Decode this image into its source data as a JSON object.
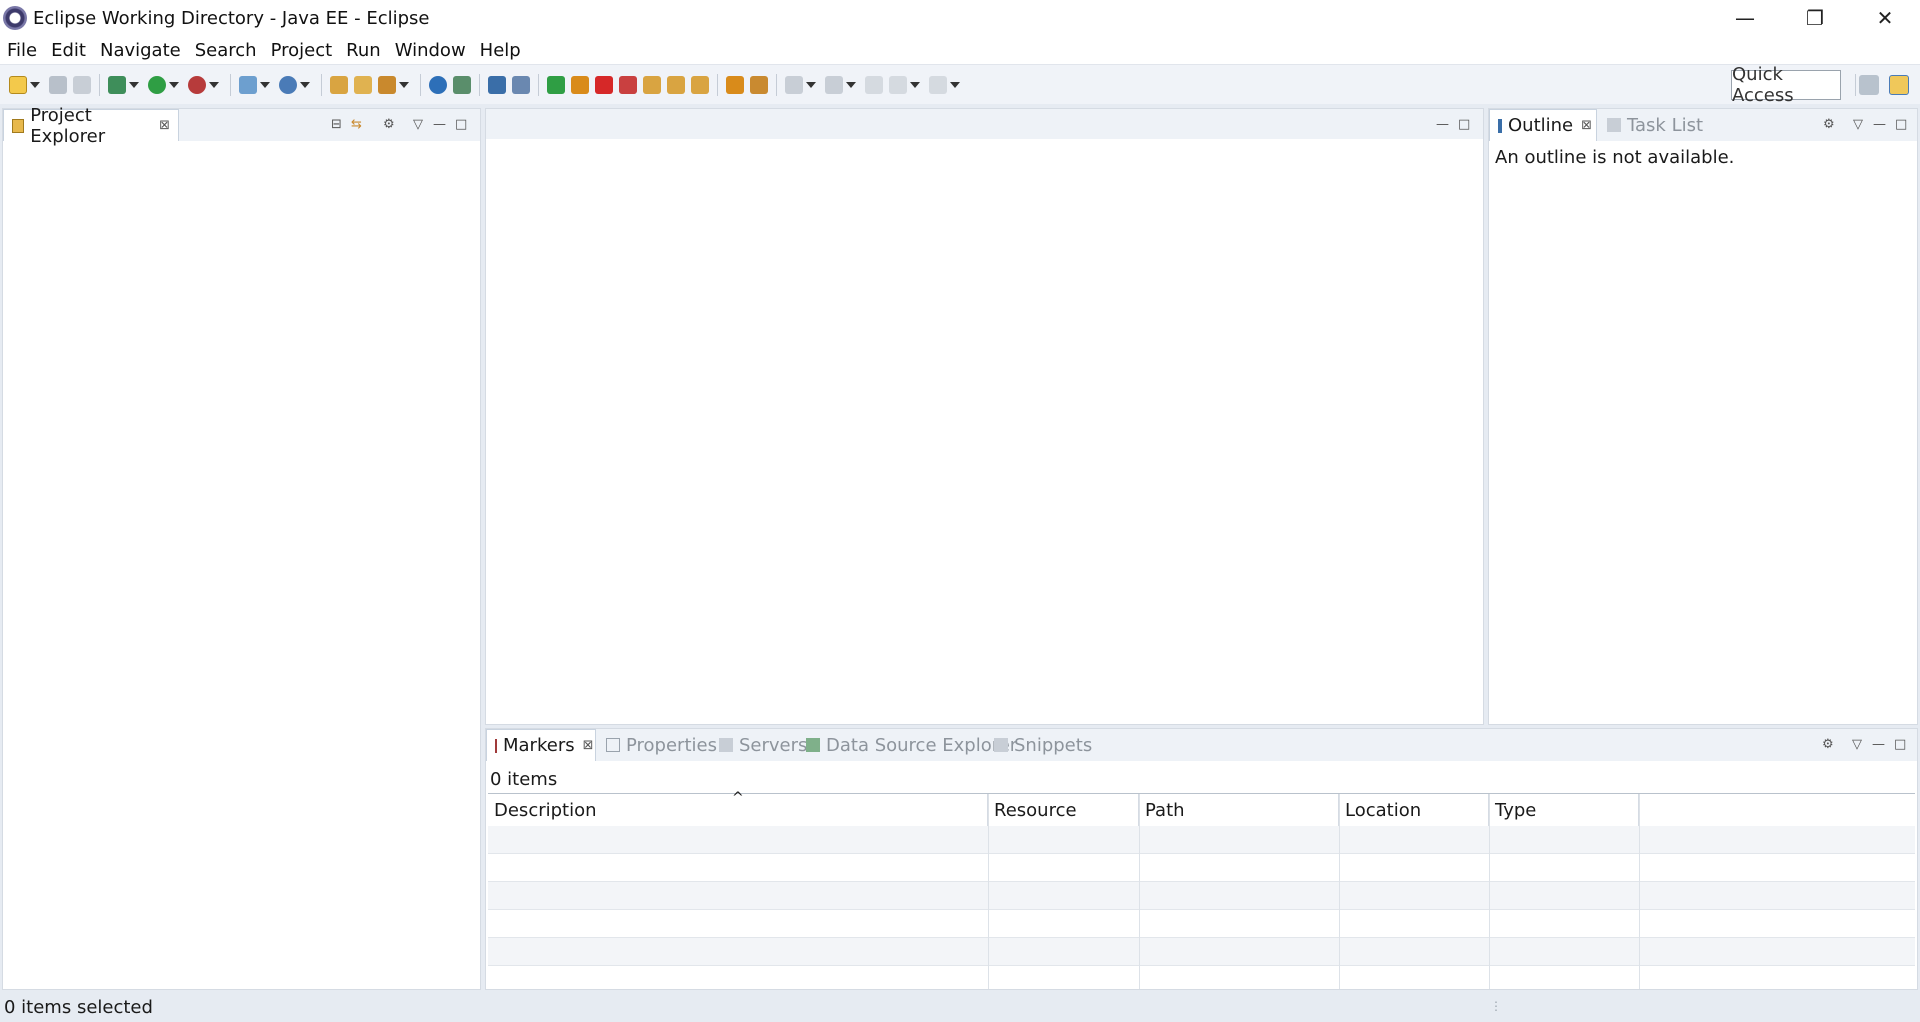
{
  "window": {
    "title": "Eclipse Working Directory - Java EE - Eclipse",
    "minimize": "—",
    "restore": "❐",
    "close": "✕"
  },
  "menu": [
    "File",
    "Edit",
    "Navigate",
    "Search",
    "Project",
    "Run",
    "Window",
    "Help"
  ],
  "toolbar": {
    "quick_access": "Quick Access"
  },
  "project_explorer": {
    "tab_label": "Project Explorer"
  },
  "outline_panel": {
    "tabs": [
      {
        "label": "Outline",
        "active": true
      },
      {
        "label": "Task List",
        "active": false
      }
    ],
    "message": "An outline is not available."
  },
  "bottom_panel": {
    "tabs": [
      {
        "label": "Markers",
        "active": true
      },
      {
        "label": "Properties",
        "active": false
      },
      {
        "label": "Servers",
        "active": false
      },
      {
        "label": "Data Source Explorer",
        "active": false
      },
      {
        "label": "Snippets",
        "active": false
      }
    ],
    "items_count": "0 items",
    "sort_indicator": "^",
    "columns": [
      "Description",
      "Resource",
      "Path",
      "Location",
      "Type"
    ]
  },
  "status": {
    "text": "0 items selected"
  },
  "colors": {
    "accent_green": "#2f9e44",
    "accent_red": "#d62828",
    "accent_orange": "#d98b1a",
    "accent_blue": "#2d6fb8"
  }
}
